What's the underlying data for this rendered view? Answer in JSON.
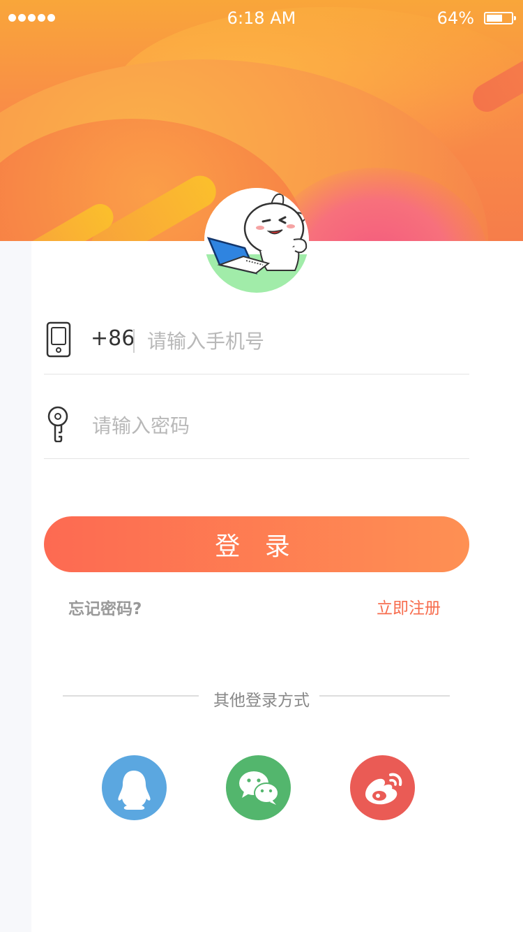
{
  "status_bar": {
    "time": "6:18 AM",
    "battery_text": "64%",
    "battery_level": 0.64
  },
  "login_form": {
    "country_code": "+86",
    "phone_placeholder": "请输入手机号",
    "password_placeholder": "请输入密码",
    "login_button": "登 录",
    "forgot_password": "忘记密码?",
    "register": "立即注册"
  },
  "other_login": {
    "label": "其他登录方式",
    "providers": [
      {
        "name": "qq-icon",
        "color": "#5ba7e0"
      },
      {
        "name": "wechat-icon",
        "color": "#53b66d"
      },
      {
        "name": "weibo-icon",
        "color": "#ea5b55"
      }
    ]
  },
  "colors": {
    "accent": "#f76c4d",
    "button_start": "#fd6a52",
    "button_end": "#fe9053"
  }
}
